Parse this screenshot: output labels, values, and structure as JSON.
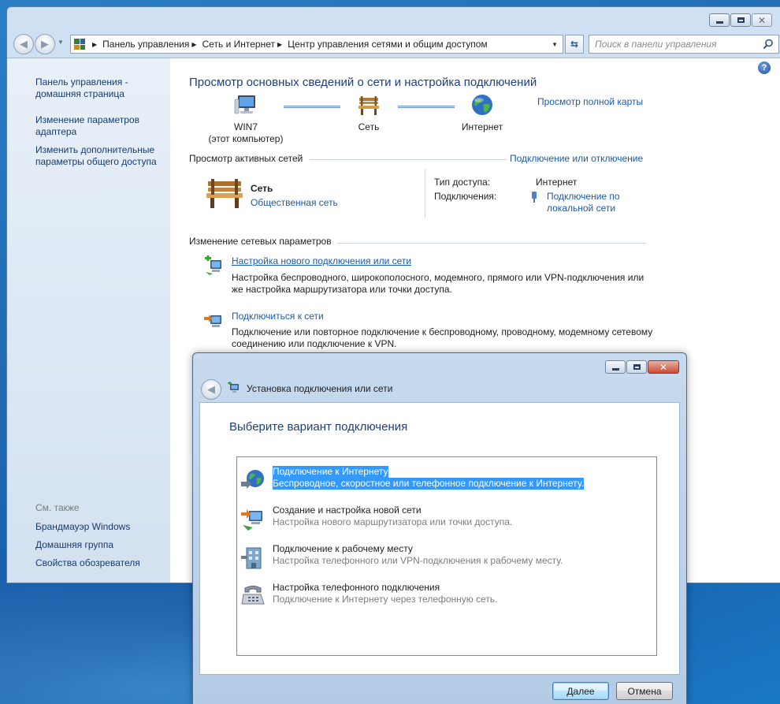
{
  "main_window": {
    "breadcrumb": [
      "Панель управления",
      "Сеть и Интернет",
      "Центр управления сетями и общим доступом"
    ],
    "search_placeholder": "Поиск в панели управления",
    "sidebar": {
      "links": [
        "Панель управления - домашняя страница",
        "Изменение параметров адаптера",
        "Изменить дополнительные параметры общего доступа"
      ],
      "see_also_label": "См. также",
      "see_also": [
        "Брандмауэр Windows",
        "Домашняя группа",
        "Свойства обозревателя"
      ]
    },
    "page_title": "Просмотр основных сведений о сети и настройка подключений",
    "map_link": "Просмотр полной карты",
    "map": {
      "computer_name": "WIN7",
      "computer_note": "(этот компьютер)",
      "network": "Сеть",
      "internet": "Интернет"
    },
    "active_networks": {
      "heading": "Просмотр активных сетей",
      "connect_link": "Подключение или отключение",
      "network_name": "Сеть",
      "network_type": "Общественная сеть",
      "access_type_label": "Тип доступа:",
      "access_type_value": "Интернет",
      "connections_label": "Подключения:",
      "connections_value": "Подключение по локальной сети"
    },
    "change_settings": {
      "heading": "Изменение сетевых параметров",
      "tasks": [
        {
          "title": "Настройка нового подключения или сети",
          "desc": "Настройка беспроводного, широкополосного, модемного, прямого или VPN-подключения или же настройка маршрутизатора или точки доступа."
        },
        {
          "title": "Подключиться к сети",
          "desc": "Подключение или повторное подключение к беспроводному, проводному, модемному сетевому соединению или подключение к VPN."
        }
      ]
    }
  },
  "wizard": {
    "title": "Установка подключения или сети",
    "heading": "Выберите вариант подключения",
    "options": [
      {
        "title": "Подключение к Интернету",
        "desc": "Беспроводное, скоростное или телефонное подключение к Интернету.",
        "icon": "globe-connect-icon",
        "selected": true
      },
      {
        "title": "Создание и настройка новой сети",
        "desc": "Настройка нового маршрутизатора или точки доступа.",
        "icon": "new-network-icon",
        "selected": false
      },
      {
        "title": "Подключение к рабочему месту",
        "desc": "Настройка телефонного или VPN-подключения к рабочему месту.",
        "icon": "workplace-icon",
        "selected": false
      },
      {
        "title": "Настройка телефонного подключения",
        "desc": "Подключение к Интернету через телефонную сеть.",
        "icon": "phone-modem-icon",
        "selected": false
      }
    ],
    "buttons": {
      "next": "Далее",
      "cancel": "Отмена"
    }
  },
  "colors": {
    "link": "#1a5aa8",
    "selection": "#3399ff",
    "title_blue": "#1e3f7a"
  }
}
